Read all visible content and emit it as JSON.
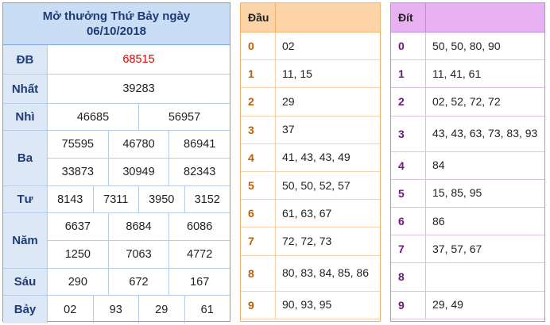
{
  "results": {
    "title": "Mở thưởng Thứ Bảy ngày",
    "date": "06/10/2018",
    "prizes": [
      {
        "label": "ĐB",
        "lines": [
          [
            "68515"
          ]
        ],
        "highlight": true
      },
      {
        "label": "Nhất",
        "lines": [
          [
            "39283"
          ]
        ]
      },
      {
        "label": "Nhì",
        "lines": [
          [
            "46685",
            "56957"
          ]
        ]
      },
      {
        "label": "Ba",
        "lines": [
          [
            "75595",
            "46780",
            "86941"
          ],
          [
            "33873",
            "30949",
            "82343"
          ]
        ]
      },
      {
        "label": "Tư",
        "lines": [
          [
            "8143",
            "7311",
            "3950",
            "3152"
          ]
        ]
      },
      {
        "label": "Năm",
        "lines": [
          [
            "6637",
            "8684",
            "6086"
          ],
          [
            "1250",
            "7063",
            "4772"
          ]
        ]
      },
      {
        "label": "Sáu",
        "lines": [
          [
            "290",
            "672",
            "167"
          ]
        ]
      },
      {
        "label": "Bảy",
        "lines": [
          [
            "02",
            "93",
            "29",
            "61"
          ]
        ]
      }
    ]
  },
  "dau": {
    "header": "Đầu",
    "rows": [
      {
        "k": "0",
        "v": "02"
      },
      {
        "k": "1",
        "v": "11, 15"
      },
      {
        "k": "2",
        "v": "29"
      },
      {
        "k": "3",
        "v": "37"
      },
      {
        "k": "4",
        "v": "41, 43, 43, 49"
      },
      {
        "k": "5",
        "v": "50, 50, 52, 57"
      },
      {
        "k": "6",
        "v": "61, 63, 67"
      },
      {
        "k": "7",
        "v": "72, 72, 73"
      },
      {
        "k": "8",
        "v": "80, 83, 84, 85, 86"
      },
      {
        "k": "9",
        "v": "90, 93, 95"
      }
    ]
  },
  "dit": {
    "header": "Đít",
    "rows": [
      {
        "k": "0",
        "v": "50, 50, 80, 90"
      },
      {
        "k": "1",
        "v": "11, 41, 61"
      },
      {
        "k": "2",
        "v": "02, 52, 72, 72"
      },
      {
        "k": "3",
        "v": "43, 43, 63, 73, 83, 93"
      },
      {
        "k": "4",
        "v": "84"
      },
      {
        "k": "5",
        "v": "15, 85, 95"
      },
      {
        "k": "6",
        "v": "86"
      },
      {
        "k": "7",
        "v": "37, 57, 67"
      },
      {
        "k": "8",
        "v": ""
      },
      {
        "k": "9",
        "v": "29, 49"
      }
    ]
  }
}
